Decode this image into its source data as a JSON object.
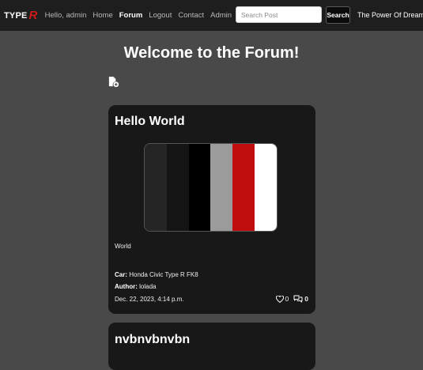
{
  "nav": {
    "brand_text": "TYPE",
    "brand_mark": "R",
    "links": [
      {
        "label": "Hello, admin",
        "active": false
      },
      {
        "label": "Home",
        "active": false
      },
      {
        "label": "Forum",
        "active": true
      },
      {
        "label": "Logout",
        "active": false
      },
      {
        "label": "Contact",
        "active": false
      },
      {
        "label": "Admin",
        "active": false
      }
    ],
    "search_placeholder": "Search Post",
    "search_button": "Search",
    "tagline": "The Power Of Dreams"
  },
  "page_title": "Welcome to the Forum!",
  "icons": {
    "new_post": "file-plus-icon",
    "like": "heart-icon",
    "comment": "comments-icon"
  },
  "posts": [
    {
      "title": "Hello World",
      "swatch_colors": [
        "#252525",
        "#141414",
        "#000000",
        "#9b9b9b",
        "#c00d0d",
        "#ffffff"
      ],
      "body": "World",
      "car_label": "Car:",
      "car": "Honda Civic Type R FK8",
      "author_label": "Author:",
      "author": "lolada",
      "date": "Dec. 22, 2023, 4:14 p.m.",
      "likes": "0",
      "comments": "0"
    },
    {
      "title": "nvbnvbnvbn"
    }
  ]
}
